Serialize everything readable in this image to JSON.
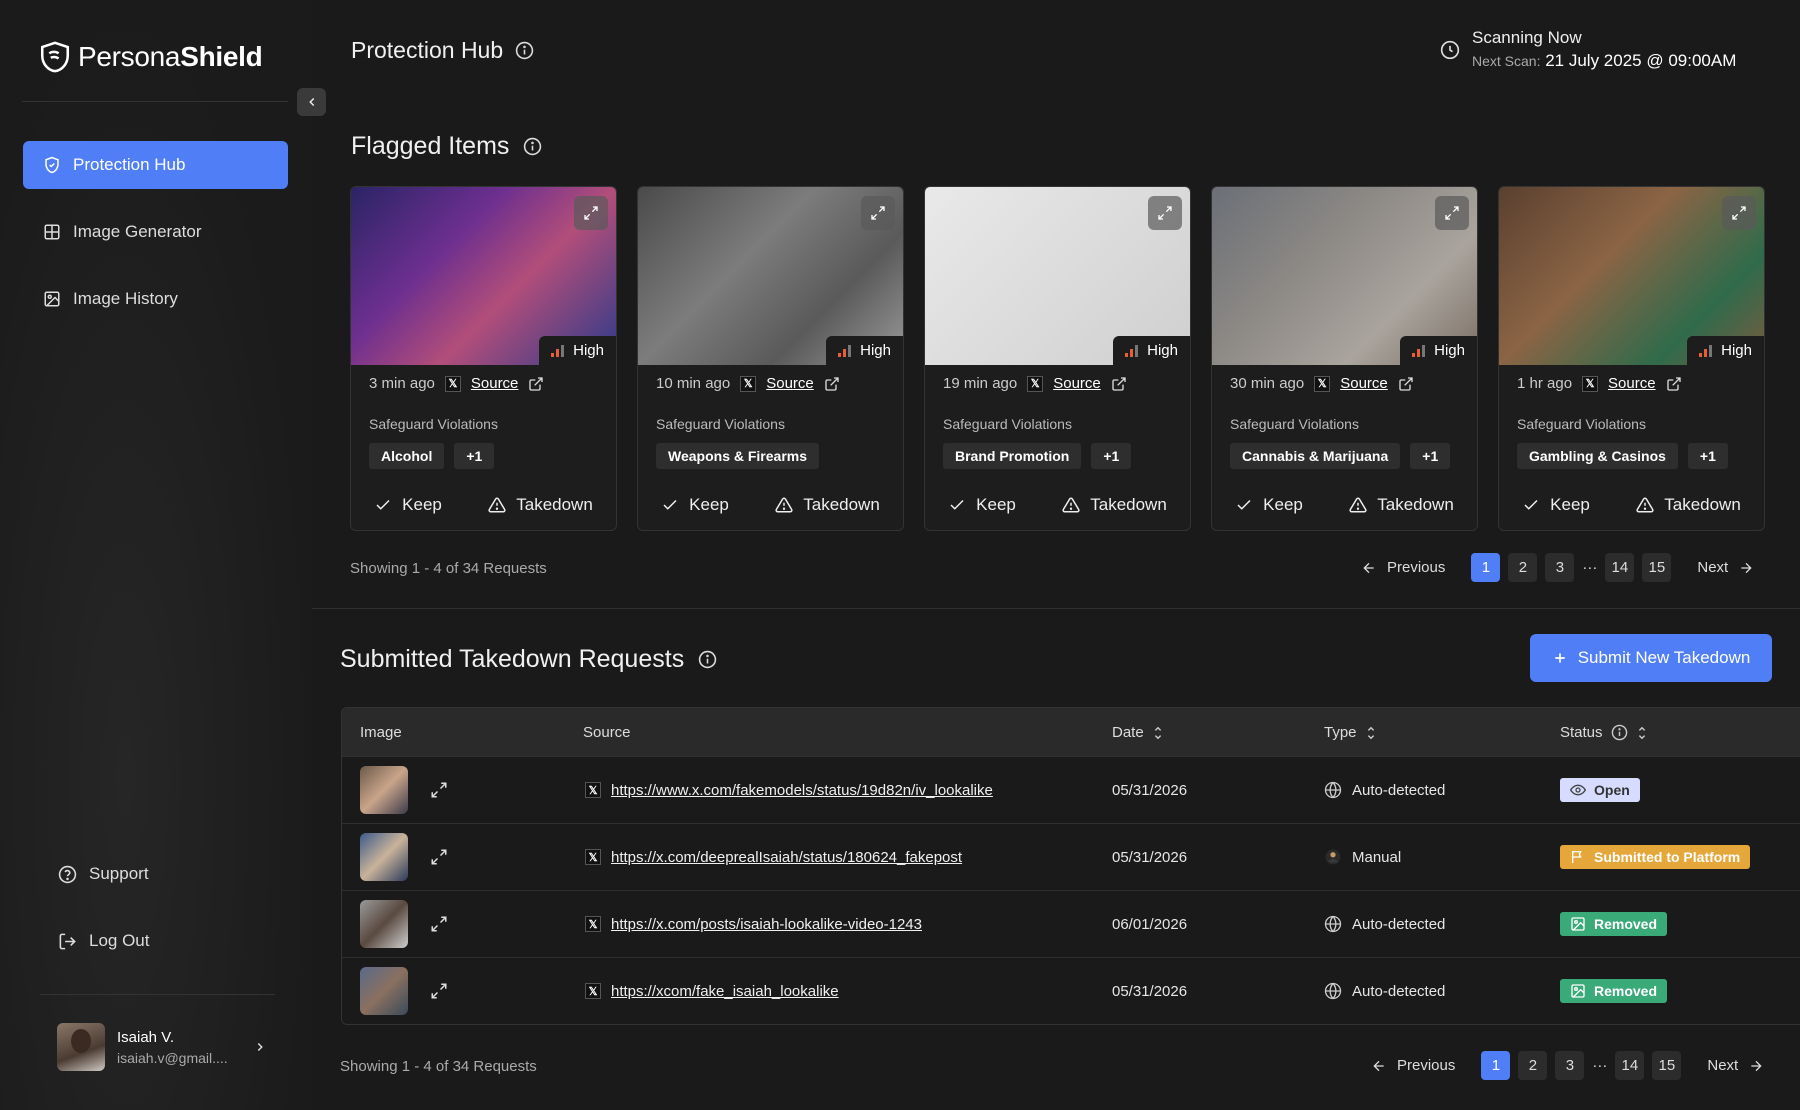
{
  "brand": {
    "name_light": "Persona",
    "name_bold": "Shield"
  },
  "sidebar": {
    "items": [
      {
        "label": "Protection Hub",
        "icon": "shield-icon",
        "active": true
      },
      {
        "label": "Image Generator",
        "icon": "grid-icon"
      },
      {
        "label": "Image History",
        "icon": "image-icon"
      }
    ],
    "support": "Support",
    "logout": "Log Out",
    "user": {
      "name": "Isaiah V.",
      "email": "isaiah.v@gmail...."
    }
  },
  "header": {
    "title": "Protection Hub",
    "scan_title": "Scanning Now",
    "scan_next_label": "Next Scan:",
    "scan_next_value": "21 July 2025 @ 09:00AM"
  },
  "flagged": {
    "title": "Flagged Items",
    "violations_label": "Safeguard Violations",
    "keep_label": "Keep",
    "takedown_label": "Takedown",
    "cards": [
      {
        "time": "3 min ago",
        "source": "Source",
        "severity": "High",
        "tag": "Alcohol",
        "extra": "+1",
        "bg": "linear-gradient(135deg,#2a2466 0%,#6d2f8f 35%,#b24e7a 60%,#2b3a8a 100%)"
      },
      {
        "time": "10 min ago",
        "source": "Source",
        "severity": "High",
        "tag": "Weapons & Firearms",
        "extra": "",
        "bg": "linear-gradient(135deg,#4a4a4a 0%,#7c7c7c 40%,#5a5a5a 70%,#9a9a9a 100%)"
      },
      {
        "time": "19 min ago",
        "source": "Source",
        "severity": "High",
        "tag": "Brand Promotion",
        "extra": "+1",
        "bg": "linear-gradient(135deg,#e9e9e9 0%,#dcdcdc 50%,#cfcfcf 100%)"
      },
      {
        "time": "30 min ago",
        "source": "Source",
        "severity": "High",
        "tag": "Cannabis & Marijuana",
        "extra": "+1",
        "bg": "linear-gradient(135deg,#6b6f76 0%,#8e8a86 40%,#a9a49d 70%,#7c6f66 100%)"
      },
      {
        "time": "1 hr ago",
        "source": "Source",
        "severity": "High",
        "tag": "Gambling & Casinos",
        "extra": "+1",
        "bg": "linear-gradient(135deg,#5a4030 0%,#8b6444 40%,#2f6b4b 75%,#7a5a3f 100%)"
      }
    ],
    "pager_info": "Showing 1 - 4 of 34 Requests",
    "pager": {
      "prev": "Previous",
      "next": "Next",
      "pages": [
        "1",
        "2",
        "3",
        "14",
        "15"
      ],
      "ellipsis": "···",
      "active": "1"
    }
  },
  "takedowns": {
    "title": "Submitted Takedown Requests",
    "submit_label": "Submit New Takedown",
    "columns": {
      "image": "Image",
      "source": "Source",
      "date": "Date",
      "type": "Type",
      "status": "Status"
    },
    "rows": [
      {
        "url": "https://www.x.com/fakemodels/status/19d82n/iv_lookalike",
        "date": "05/31/2026",
        "type": "Auto-detected",
        "type_icon": "globe-icon",
        "status": "Open",
        "status_kind": "open",
        "thumb": "linear-gradient(135deg,#6b5a4a,#c9a58a,#3d3a4a)"
      },
      {
        "url": "https://x.com/deeprealIsaiah/status/180624_fakepost",
        "date": "05/31/2026",
        "type": "Manual",
        "type_icon": "user-icon",
        "status": "Submitted to Platform",
        "status_kind": "submitted",
        "thumb": "linear-gradient(135deg,#3d5a8a,#c9b39a,#2b3a5a)"
      },
      {
        "url": "https://x.com/posts/isaiah-lookalike-video-1243",
        "date": "06/01/2026",
        "type": "Auto-detected",
        "type_icon": "globe-icon",
        "status": "Removed",
        "status_kind": "removed",
        "thumb": "linear-gradient(135deg,#9a9a9a,#5a4a40,#cfcfcf)"
      },
      {
        "url": "https://xcom/fake_isaiah_lookalike",
        "date": "05/31/2026",
        "type": "Auto-detected",
        "type_icon": "globe-icon",
        "status": "Removed",
        "status_kind": "removed",
        "thumb": "linear-gradient(135deg,#5a6a8a,#8a7060,#3a4a5a)"
      }
    ],
    "pager_info": "Showing 1 - 4 of 34 Requests",
    "pager": {
      "prev": "Previous",
      "next": "Next",
      "pages": [
        "1",
        "2",
        "3",
        "14",
        "15"
      ],
      "ellipsis": "···",
      "active": "1"
    }
  }
}
